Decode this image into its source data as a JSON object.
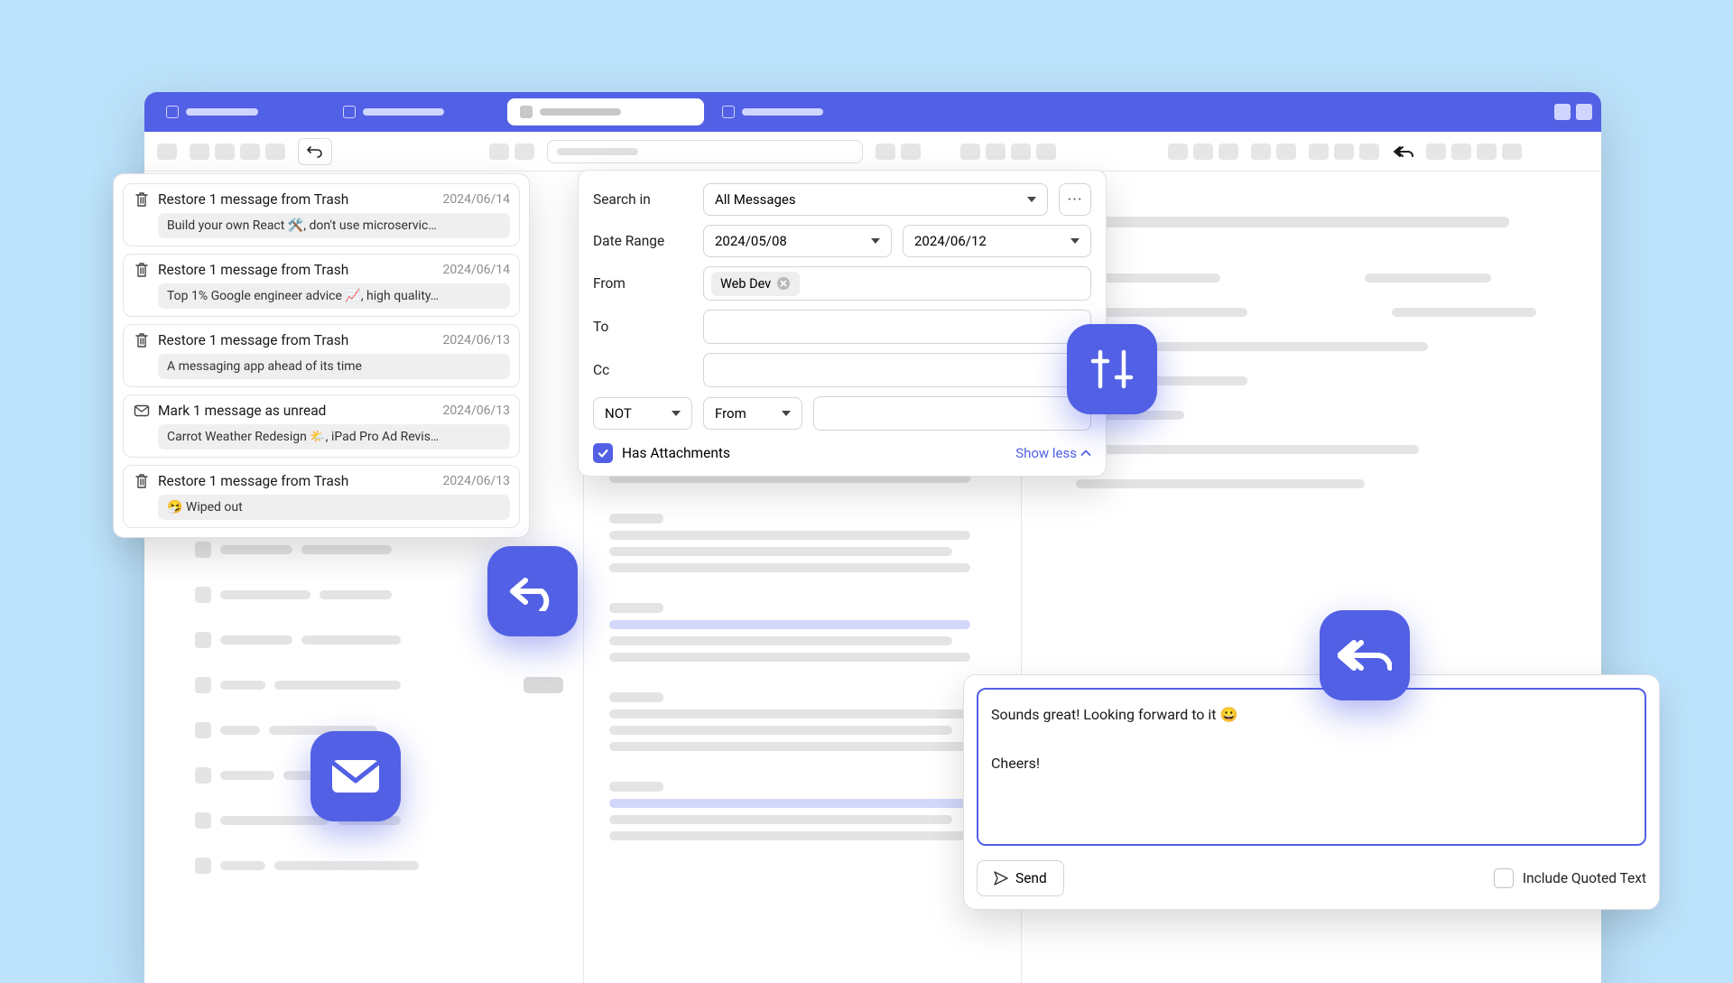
{
  "undo_panel": {
    "items": [
      {
        "icon": "trash",
        "title": "Restore 1 message from Trash",
        "date": "2024/06/14",
        "snippet": "Build your own React 🛠️, don't use microservic…"
      },
      {
        "icon": "trash",
        "title": "Restore 1 message from Trash",
        "date": "2024/06/14",
        "snippet": "Top 1% Google engineer advice 📈, high quality…"
      },
      {
        "icon": "trash",
        "title": "Restore 1 message from Trash",
        "date": "2024/06/13",
        "snippet": "A messaging app ahead of its time"
      },
      {
        "icon": "mail",
        "title": "Mark 1 message as unread",
        "date": "2024/06/13",
        "snippet": "Carrot Weather Redesign 🌤️, iPad Pro Ad Revis…"
      },
      {
        "icon": "trash",
        "title": "Restore 1 message from Trash",
        "date": "2024/06/13",
        "snippet": "🤧 Wiped out"
      }
    ]
  },
  "search": {
    "search_in_label": "Search in",
    "search_in_value": "All Messages",
    "date_range_label": "Date Range",
    "date_from": "2024/05/08",
    "date_to": "2024/06/12",
    "from_label": "From",
    "from_chip": "Web Dev",
    "to_label": "To",
    "cc_label": "Cc",
    "op_select": "NOT",
    "field_select": "From",
    "has_attachments_label": "Has Attachments",
    "has_attachments_checked": true,
    "show_less_label": "Show less"
  },
  "compose": {
    "body": "Sounds great! Looking forward to it 😀\n\nCheers!",
    "send_label": "Send",
    "quoted_label": "Include Quoted Text",
    "quoted_checked": false
  }
}
